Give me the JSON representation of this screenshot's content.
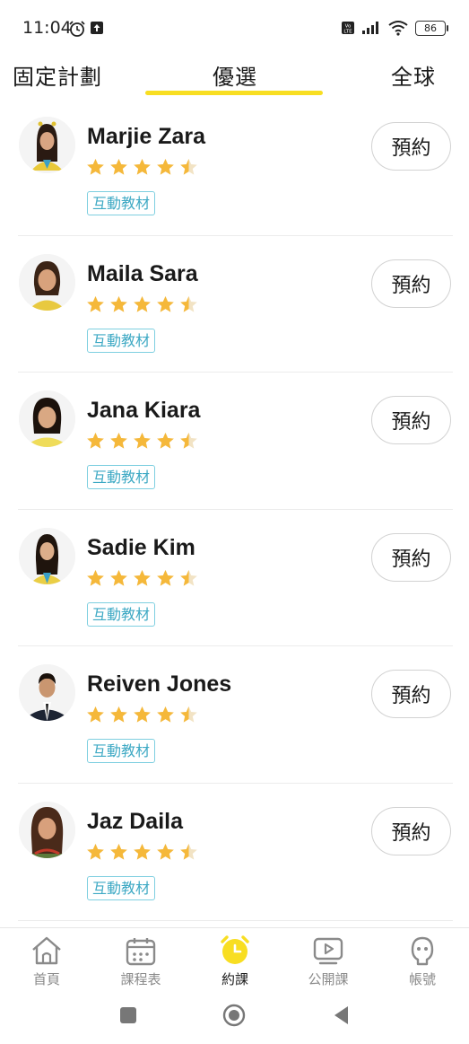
{
  "status_bar": {
    "time": "11:04",
    "battery": "86",
    "icons": [
      "alarm-icon",
      "upload-icon",
      "volte-icon",
      "signal-icon",
      "wifi-icon",
      "battery-icon"
    ]
  },
  "tabs": [
    {
      "label": "固定計劃",
      "active": false
    },
    {
      "label": "優選",
      "active": true
    },
    {
      "label": "全球",
      "active": false
    }
  ],
  "teachers": [
    {
      "name": "Marjie Zara",
      "rating": 4.5,
      "tag": "互動教材",
      "button": "預約"
    },
    {
      "name": "Maila Sara",
      "rating": 4.5,
      "tag": "互動教材",
      "button": "預約"
    },
    {
      "name": "Jana Kiara",
      "rating": 4.5,
      "tag": "互動教材",
      "button": "預約"
    },
    {
      "name": "Sadie Kim",
      "rating": 4.5,
      "tag": "互動教材",
      "button": "預約"
    },
    {
      "name": "Reiven Jones",
      "rating": 4.5,
      "tag": "互動教材",
      "button": "預約"
    },
    {
      "name": "Jaz Daila",
      "rating": 4.5,
      "tag": "互動教材",
      "button": "預約"
    }
  ],
  "bottom_nav": [
    {
      "label": "首頁",
      "icon": "home-icon",
      "active": false
    },
    {
      "label": "課程表",
      "icon": "calendar-icon",
      "active": false
    },
    {
      "label": "約課",
      "icon": "alarm-clock-icon",
      "active": true
    },
    {
      "label": "公開課",
      "icon": "video-play-icon",
      "active": false
    },
    {
      "label": "帳號",
      "icon": "user-face-icon",
      "active": false
    }
  ],
  "colors": {
    "accent_yellow": "#f8de22",
    "star": "#f5b83a",
    "tag_text": "#3ea9c4",
    "tag_border": "#7ecfe0",
    "nav_inactive": "#8a8a8a"
  }
}
